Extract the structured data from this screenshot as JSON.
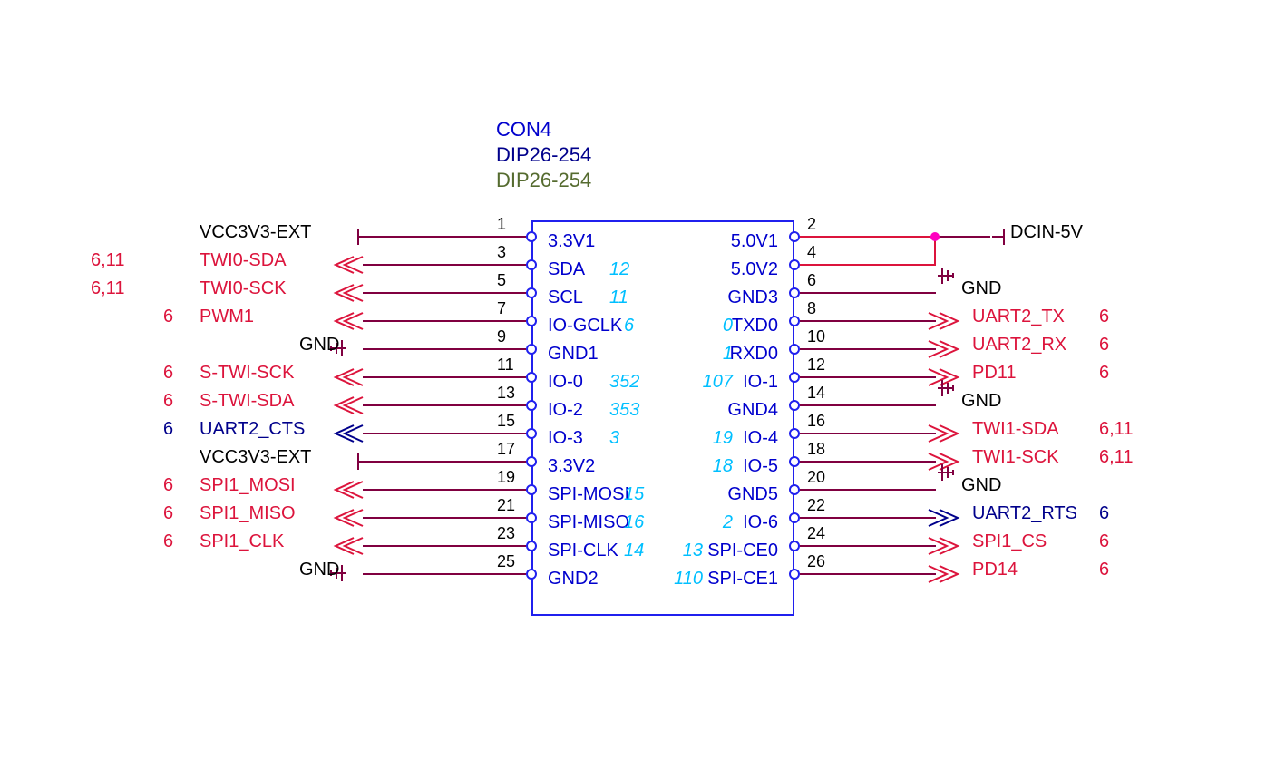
{
  "header": {
    "ref": "CON4",
    "val": "DIP26-254",
    "fp": "DIP26-254"
  },
  "left": [
    {
      "pin": "1",
      "label": "3.3V1",
      "net": "VCC3V3-EXT",
      "sheet": "",
      "gpio": "",
      "type": "pwr"
    },
    {
      "pin": "3",
      "label": "SDA",
      "net": "TWI0-SDA",
      "sheet": "6,11",
      "gpio": "12",
      "type": "out"
    },
    {
      "pin": "5",
      "label": "SCL",
      "net": "TWI0-SCK",
      "sheet": "6,11",
      "gpio": "11",
      "type": "out"
    },
    {
      "pin": "7",
      "label": "IO-GCLK",
      "net": "PWM1",
      "sheet": "6",
      "gpio": "6",
      "type": "out"
    },
    {
      "pin": "9",
      "label": "GND1",
      "net": "GND",
      "sheet": "",
      "gpio": "",
      "type": "gnd"
    },
    {
      "pin": "11",
      "label": "IO-0",
      "net": "S-TWI-SCK",
      "sheet": "6",
      "gpio": "352",
      "type": "out"
    },
    {
      "pin": "13",
      "label": "IO-2",
      "net": "S-TWI-SDA",
      "sheet": "6",
      "gpio": "353",
      "type": "out"
    },
    {
      "pin": "15",
      "label": "IO-3",
      "net": "UART2_CTS",
      "sheet": "6",
      "gpio": "3",
      "type": "in-blue"
    },
    {
      "pin": "17",
      "label": "3.3V2",
      "net": "VCC3V3-EXT",
      "sheet": "",
      "gpio": "",
      "type": "pwr"
    },
    {
      "pin": "19",
      "label": "SPI-MOSI",
      "net": "SPI1_MOSI",
      "sheet": "6",
      "gpio": "15",
      "type": "out"
    },
    {
      "pin": "21",
      "label": "SPI-MISO",
      "net": "SPI1_MISO",
      "sheet": "6",
      "gpio": "16",
      "type": "out"
    },
    {
      "pin": "23",
      "label": "SPI-CLK",
      "net": "SPI1_CLK",
      "sheet": "6",
      "gpio": "14",
      "type": "out"
    },
    {
      "pin": "25",
      "label": "GND2",
      "net": "GND",
      "sheet": "",
      "gpio": "",
      "type": "gnd"
    }
  ],
  "right": [
    {
      "pin": "2",
      "label": "5.0V1",
      "net": "DCIN-5V",
      "sheet": "",
      "gpio": "",
      "type": "pwr2"
    },
    {
      "pin": "4",
      "label": "5.0V2",
      "net": "",
      "sheet": "",
      "gpio": "",
      "type": "pwr2b"
    },
    {
      "pin": "6",
      "label": "GND3",
      "net": "GND",
      "sheet": "",
      "gpio": "",
      "type": "gnd"
    },
    {
      "pin": "8",
      "label": "TXD0",
      "net": "UART2_TX",
      "sheet": "6",
      "gpio": "0",
      "type": "in"
    },
    {
      "pin": "10",
      "label": "RXD0",
      "net": "UART2_RX",
      "sheet": "6",
      "gpio": "1",
      "type": "in"
    },
    {
      "pin": "12",
      "label": "IO-1",
      "net": "PD11",
      "sheet": "6",
      "gpio": "107",
      "type": "in"
    },
    {
      "pin": "14",
      "label": "GND4",
      "net": "GND",
      "sheet": "",
      "gpio": "",
      "type": "gnd"
    },
    {
      "pin": "16",
      "label": "IO-4",
      "net": "TWI1-SDA",
      "sheet": "6,11",
      "gpio": "19",
      "type": "in"
    },
    {
      "pin": "18",
      "label": "IO-5",
      "net": "TWI1-SCK",
      "sheet": "6,11",
      "gpio": "18",
      "type": "in"
    },
    {
      "pin": "20",
      "label": "GND5",
      "net": "GND",
      "sheet": "",
      "gpio": "",
      "type": "gnd"
    },
    {
      "pin": "22",
      "label": "IO-6",
      "net": "UART2_RTS",
      "sheet": "6",
      "gpio": "2",
      "type": "in-blue"
    },
    {
      "pin": "24",
      "label": "SPI-CE0",
      "net": "SPI1_CS",
      "sheet": "6",
      "gpio": "13",
      "type": "in"
    },
    {
      "pin": "26",
      "label": "SPI-CE1",
      "net": "PD14",
      "sheet": "6",
      "gpio": "110",
      "type": "in"
    }
  ]
}
